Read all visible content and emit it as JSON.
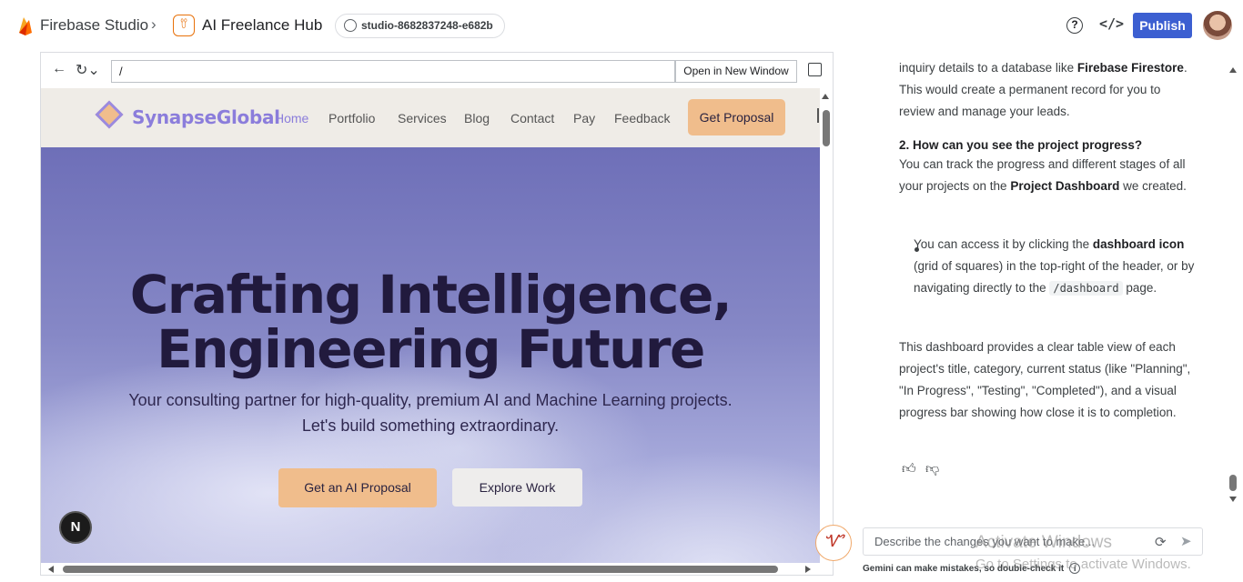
{
  "topbar": {
    "brand": "Firebase Studio",
    "project": "AI Freelance Hub",
    "workspace": "studio-8682837248-e682b",
    "help": "?",
    "code": "</>",
    "publish": "Publish"
  },
  "preview": {
    "url": "/",
    "open_new_window": "Open in New Window"
  },
  "site": {
    "name": "SynapseGlobal",
    "nav": [
      "Home",
      "Portfolio",
      "Services",
      "Blog",
      "Contact",
      "Pay",
      "Feedback"
    ],
    "nav_cta": "Get Proposal",
    "hero_line1": "Crafting Intelligence,",
    "hero_line2": "Engineering Future",
    "hero_sub": "Your consulting partner for high-quality, premium AI and Machine Learning projects. Let's build something extraordinary.",
    "btn_primary": "Get an AI Proposal",
    "btn_secondary": "Explore Work",
    "next_badge": "N"
  },
  "chat": {
    "p1_a": "inquiry details to a database like ",
    "p1_b": "Firebase Firestore",
    "p1_c": ". This would create a permanent record for you to review and manage your leads.",
    "q2": "2. How can you see the project progress?",
    "p2_a": "You can track the progress and different stages of all your projects on the ",
    "p2_b": "Project Dashboard",
    "p2_c": " we created.",
    "li_a": "You can access it by clicking the ",
    "li_b": "dashboard icon",
    "li_c": " (grid of squares) in the top-right of the header, or by navigating directly to the ",
    "li_code": "/dashboard",
    "li_d": " page.",
    "p3": "This dashboard provides a clear table view of each project's title, category, current status (like \"Planning\", \"In Progress\", \"Testing\", \"Completed\"), and a visual progress bar showing how close it is to completion."
  },
  "prompt": {
    "placeholder": "Describe the changes you want to make...",
    "disclaimer": "Gemini can make mistakes, so double-check it"
  },
  "watermark": {
    "line1": "Activate Windows",
    "line2": "Go to Settings to activate Windows."
  },
  "colors": {
    "publish": "#3c5fd1",
    "accent_peach": "#f0bd8c",
    "brand_purple": "#8b7ddb"
  }
}
